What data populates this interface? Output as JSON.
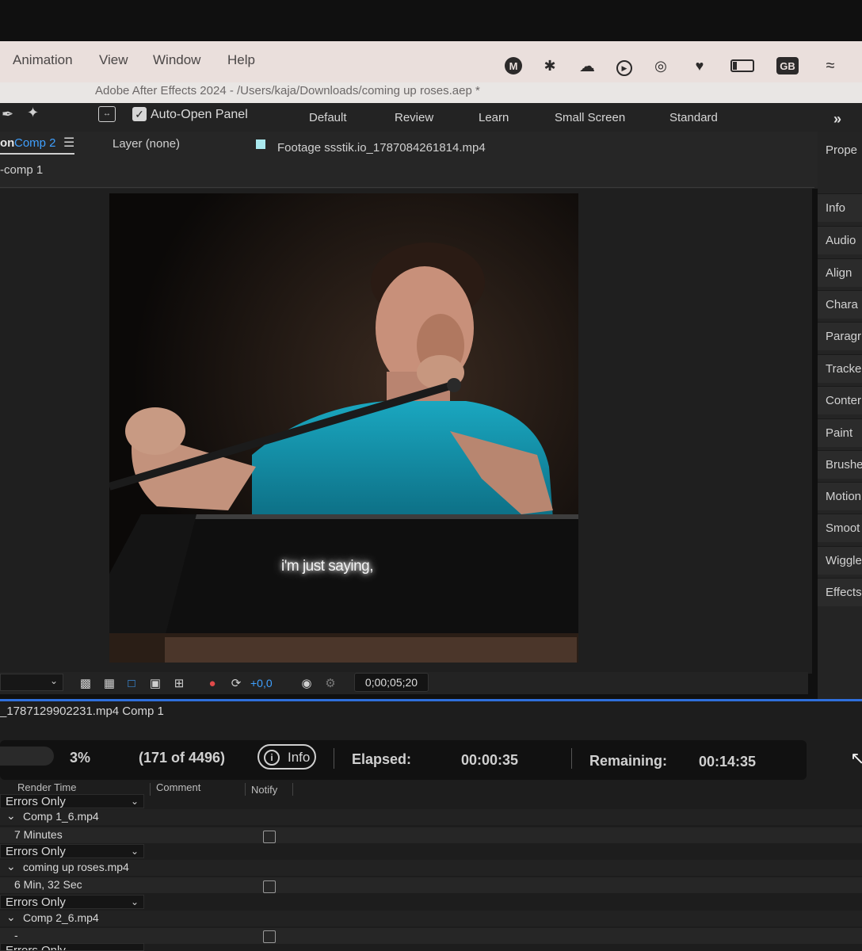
{
  "menu": {
    "items": [
      "Animation",
      "View",
      "Window",
      "Help"
    ],
    "tray_gb": "GB"
  },
  "window": {
    "title": "Adobe After Effects 2024 - /Users/kaja/Downloads/coming up roses.aep *"
  },
  "toolbar": {
    "auto_open_panel": "Auto-Open Panel",
    "workspaces": [
      "Default",
      "Review",
      "Learn",
      "Small Screen",
      "Standard"
    ]
  },
  "panels": {
    "comp_tab_prefix": "on",
    "comp_tab_name": "Comp 2",
    "layer_tab": "Layer (none)",
    "footage_tab": "Footage ssstik.io_1787084261814.mp4",
    "breadcrumb": "-comp 1"
  },
  "viewer": {
    "subtitle": "i'm just saying,",
    "exposure": "+0,0",
    "timecode": "0;00;05;20"
  },
  "right_panel": {
    "items": [
      "Prope",
      "Info",
      "Audio",
      "Align",
      "Chara",
      "Paragr",
      "Tracke",
      "Conter",
      "Paint",
      "Brushe",
      "Motion",
      "Smoot",
      "Wiggle",
      "Effects"
    ]
  },
  "render_queue": {
    "current": "_1787129902231.mp4 Comp 1",
    "progress_percent": "3%",
    "progress_value": 0.03,
    "frames": "(171 of 4496)",
    "info_label": "Info",
    "elapsed_label": "Elapsed:",
    "elapsed_value": "00:00:35",
    "remaining_label": "Remaining:",
    "remaining_value": "00:14:35",
    "columns": [
      "Render Time",
      "Comment",
      "Notify"
    ],
    "rows": [
      {
        "log": "Errors Only",
        "output": "Comp 1_6.mp4",
        "render_time": "7 Minutes"
      },
      {
        "log": "Errors Only",
        "output": "coming up roses.mp4",
        "render_time": "6 Min, 32 Sec"
      },
      {
        "log": "Errors Only",
        "output": "Comp 2_6.mp4",
        "render_time": "-"
      },
      {
        "log": "Errors Only"
      }
    ]
  }
}
